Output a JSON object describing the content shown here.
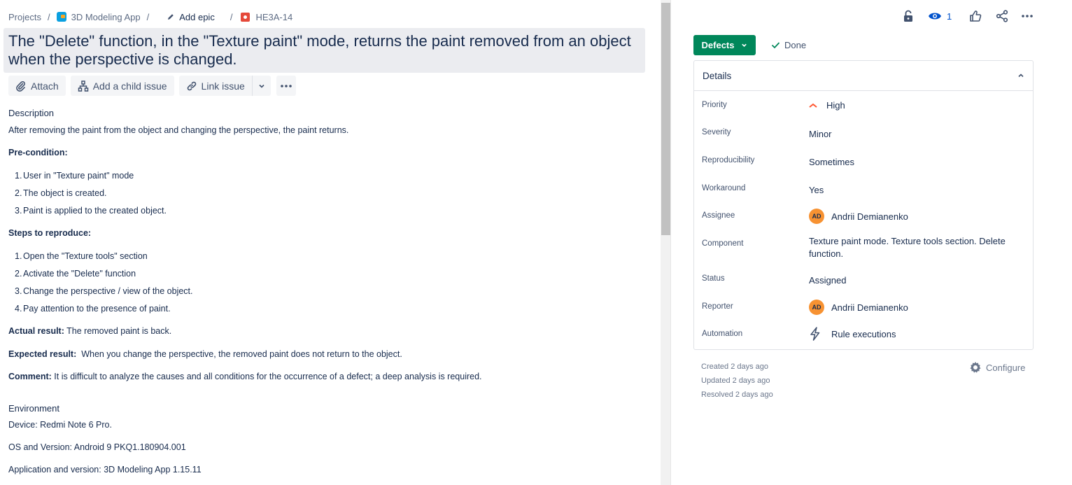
{
  "breadcrumb": {
    "projects": "Projects",
    "app": "3D Modeling App",
    "add_epic": "Add epic",
    "issue_key": "HE3A-14"
  },
  "issue": {
    "title": "The \"Delete\" function, in the \"Texture paint\" mode, returns the paint removed from an object when the perspective is changed."
  },
  "toolbar": {
    "attach": "Attach",
    "add_child": "Add a child issue",
    "link_issue": "Link issue"
  },
  "description": {
    "heading": "Description",
    "summary": "After removing the paint from the object and changing the perspective, the paint returns.",
    "precondition_heading": "Pre-condition:",
    "preconditions": [
      "User in \"Texture paint\" mode",
      "The object is created.",
      "Paint is applied to the created object."
    ],
    "steps_heading": "Steps to reproduce:",
    "steps": [
      "Open the \"Texture tools\" section",
      "Activate the \"Delete\" function",
      "Change the perspective / view of the object.",
      "Pay attention to the presence of paint."
    ],
    "actual_label": "Actual result:",
    "actual_text": " The removed paint is back.",
    "expected_label": "Expected result:",
    "expected_text": "  When you change the perspective, the removed paint does not return to the object.",
    "comment_label": "Comment:",
    "comment_text": " It is difficult to analyze the causes and all conditions for the occurrence of a defect; a deep analysis is required."
  },
  "environment": {
    "heading": "Environment",
    "device": "Device: Redmi Note 6 Pro.",
    "os": "OS and Version: Android 9 PKQ1.180904.001",
    "app": "Application and version: 3D Modeling App 1.15.11"
  },
  "top_actions": {
    "watchers": "1",
    "icons": [
      "lock-icon",
      "eye-icon",
      "thumbs-up-icon",
      "share-icon",
      "more-icon"
    ]
  },
  "status": {
    "button": "Defects",
    "resolution": "Done",
    "color": "#00875a"
  },
  "details": {
    "heading": "Details",
    "fields": {
      "priority": {
        "label": "Priority",
        "value": "High"
      },
      "severity": {
        "label": "Severity",
        "value": "Minor"
      },
      "reproducibility": {
        "label": "Reproducibility",
        "value": "Sometimes"
      },
      "workaround": {
        "label": "Workaround",
        "value": "Yes"
      },
      "assignee": {
        "label": "Assignee",
        "value": "Andrii Demianenko",
        "initials": "AD"
      },
      "component": {
        "label": "Component",
        "value_line1": "Texture paint mode. Texture tools section. Delete",
        "value_line2": "function."
      },
      "status": {
        "label": "Status",
        "value": "Assigned"
      },
      "reporter": {
        "label": "Reporter",
        "value": "Andrii Demianenko",
        "initials": "AD"
      },
      "automation": {
        "label": "Automation",
        "value": "Rule executions"
      }
    }
  },
  "meta": {
    "created": "Created 2 days ago",
    "updated": "Updated 2 days ago",
    "resolved": "Resolved 2 days ago",
    "configure": "Configure"
  }
}
